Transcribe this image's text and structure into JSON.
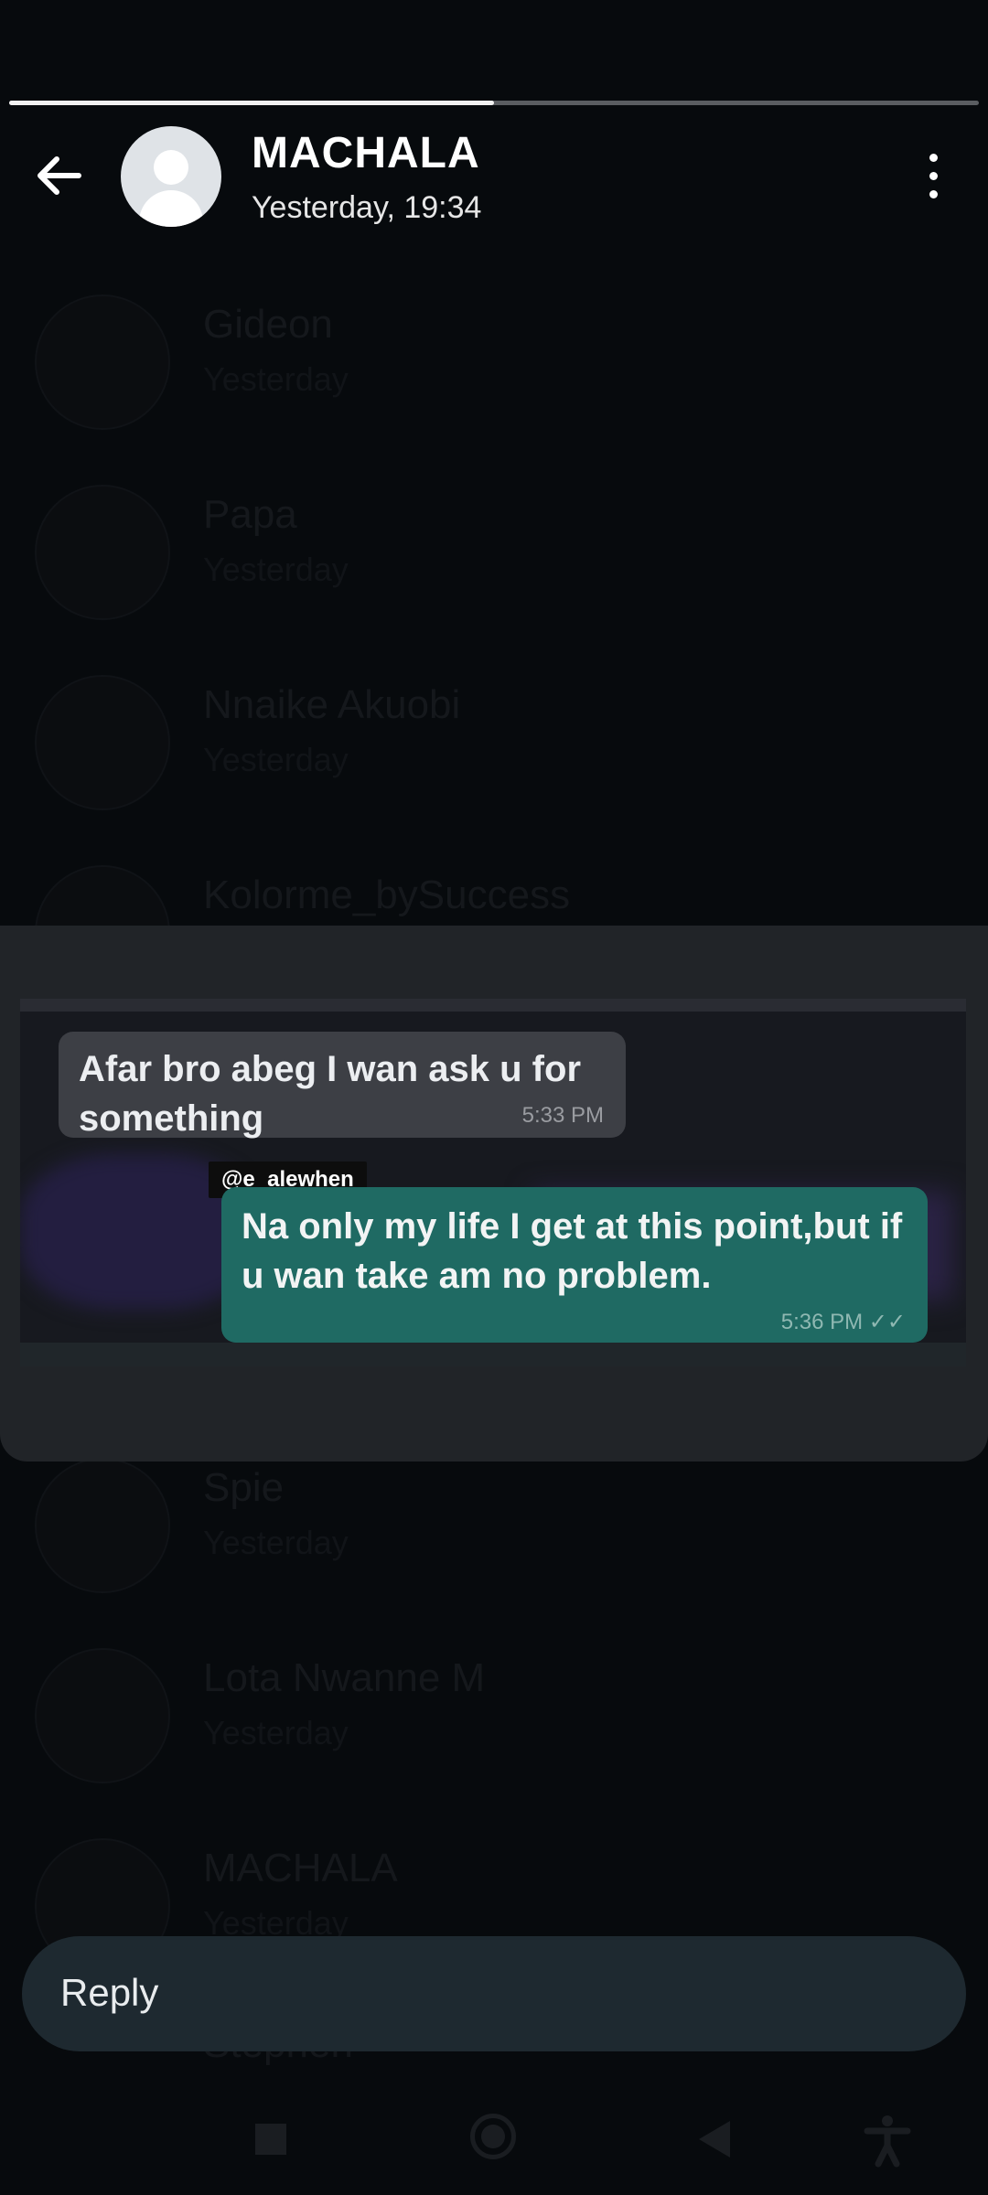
{
  "status": {
    "progress": 0.5
  },
  "header": {
    "title": "MACHALA",
    "subtitle": "Yesterday, 19:34"
  },
  "background_list": {
    "items": [
      {
        "name": "Gideon",
        "time": "Yesterday"
      },
      {
        "name": "Papa",
        "time": "Yesterday"
      },
      {
        "name": "Nnaike Akuobi",
        "time": "Yesterday"
      },
      {
        "name": "Kolorme_bySuccess",
        "time": ""
      },
      {
        "name": "Spie",
        "time": "Yesterday"
      },
      {
        "name": "Lota Nwanne M",
        "time": "Yesterday"
      },
      {
        "name": "MACHALA",
        "time": "Yesterday"
      }
    ],
    "partial": "Stephen"
  },
  "media": {
    "incoming_text": "Afar bro abeg I wan ask u for something",
    "incoming_time": "5:33 PM",
    "tag": "@e_alewhen",
    "outgoing_text": "Na only my life I get at this point,but if u wan take am no problem.",
    "outgoing_time": "5:36 PM ✓✓"
  },
  "reply": {
    "placeholder": "Reply"
  },
  "icons": {
    "back": "arrow-left-icon",
    "menu": "more-vertical-icon",
    "avatar": "default-avatar-icon",
    "nav": [
      "recents-icon",
      "home-icon",
      "back-icon",
      "accessibility-icon"
    ]
  }
}
